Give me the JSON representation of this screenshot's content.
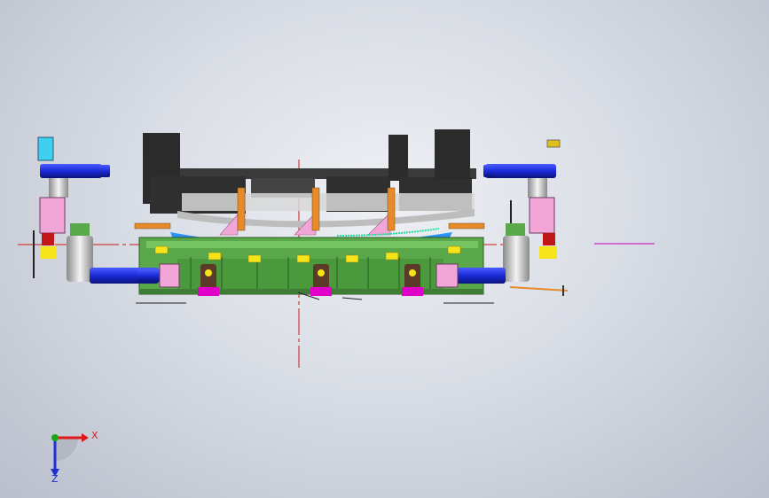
{
  "viewport": {
    "background_top": "#eef0f4",
    "background_bottom": "#b9bfcc"
  },
  "model": {
    "description_icon": "fixture-assembly-icon",
    "colors": {
      "base_green": "#5aa84a",
      "base_dark_green": "#3f7c35",
      "clamp_dark": "#2b2b2b",
      "cylinder_blue": "#1a2bd8",
      "cylinder_light_blue": "#3fd0f0",
      "pink": "#f2a6d8",
      "magenta": "#e000c8",
      "yellow": "#f6e41a",
      "orange": "#e68a2a",
      "part_blue": "#3a6fd0",
      "red_centerline": "#e01818",
      "magenta_centerline": "#c000c0"
    }
  },
  "triad": {
    "x_label": "X",
    "z_label": "Z",
    "x_color": "#e01818",
    "y_color": "#1aa81a",
    "z_color": "#2030d0"
  }
}
